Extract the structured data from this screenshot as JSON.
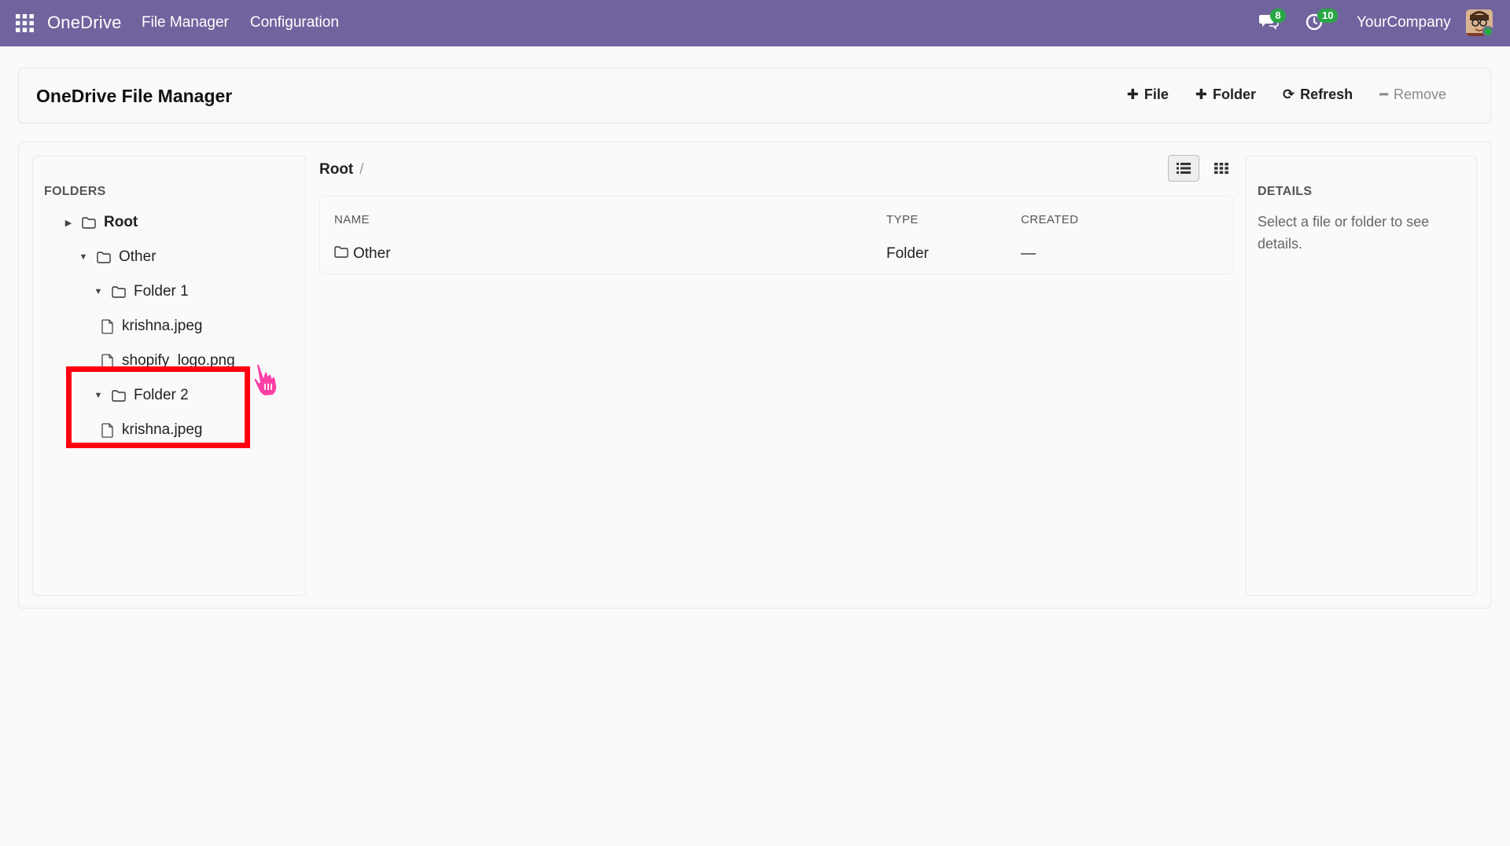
{
  "navbar": {
    "app_name": "OneDrive",
    "menu": [
      "File Manager",
      "Configuration"
    ],
    "messages_count": "8",
    "activities_count": "10",
    "company": "YourCompany",
    "accent_color": "#71639e",
    "badge_color": "#28a745"
  },
  "control_panel": {
    "title": "OneDrive File Manager",
    "actions": {
      "add_file": "File",
      "add_folder": "Folder",
      "refresh": "Refresh",
      "remove": "Remove"
    }
  },
  "folders_panel": {
    "title": "FOLDERS",
    "tree": [
      {
        "label": "Root",
        "type": "folder",
        "expanded": false
      },
      {
        "label": "Other",
        "type": "folder",
        "expanded": true
      },
      {
        "label": "Folder 1",
        "type": "folder",
        "expanded": true
      },
      {
        "label": "krishna.jpeg",
        "type": "file"
      },
      {
        "label": "shopify_logo.png",
        "type": "file"
      },
      {
        "label": "Folder 2",
        "type": "folder",
        "expanded": true
      },
      {
        "label": "krishna.jpeg",
        "type": "file"
      }
    ],
    "highlight_color": "#ff0010"
  },
  "content": {
    "breadcrumb": [
      "Root",
      "/"
    ],
    "view_modes": [
      "list-view-icon",
      "grid-view-icon"
    ],
    "active_view": "list",
    "columns": [
      "NAME",
      "TYPE",
      "CREATED"
    ],
    "rows": [
      {
        "name": "Other",
        "type": "Folder",
        "created": "—"
      }
    ]
  },
  "details_panel": {
    "title": "DETAILS",
    "placeholder": "Select a file or folder to see details."
  }
}
